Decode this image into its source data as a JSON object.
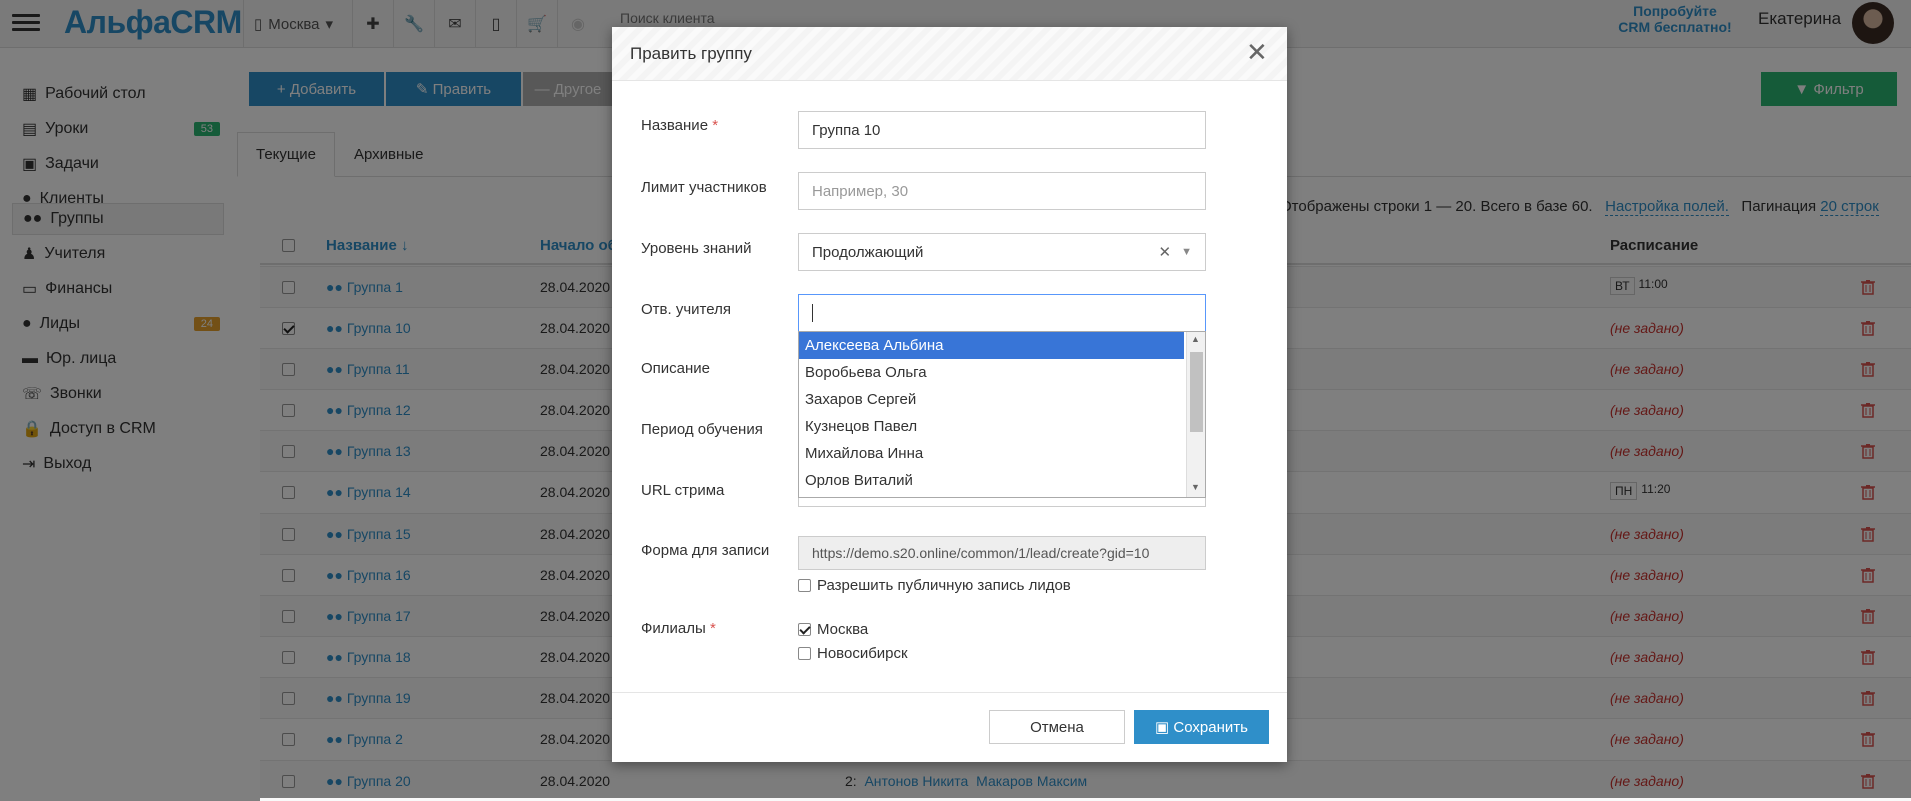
{
  "colors": {
    "primary": "#2f8fc9",
    "teal": "#2bb673",
    "orange": "#e6a12c",
    "danger": "#c9302c",
    "highlight": "#3875d7"
  },
  "topbar": {
    "logo": "АльфаCRM",
    "branch": "Москва",
    "search_placeholder": "Поиск клиента",
    "promo": [
      "Попробуйте",
      "CRM бесплатно!"
    ],
    "user": "Екатерина",
    "icons": [
      "plus-icon",
      "wrench-icon",
      "envelope-icon",
      "mobile-icon",
      "cart-icon"
    ]
  },
  "sidebar": {
    "items": [
      {
        "label": "Рабочий стол",
        "icon": "map-icon"
      },
      {
        "label": "Уроки",
        "icon": "book-icon",
        "badge": "53",
        "badge_color": "#2bb673"
      },
      {
        "label": "Задачи",
        "icon": "clipboard-icon"
      },
      {
        "label": "Клиенты",
        "icon": "user-icon"
      },
      {
        "label": "Группы",
        "icon": "users-icon",
        "active": true
      },
      {
        "label": "Учителя",
        "icon": "teacher-icon"
      },
      {
        "label": "Финансы",
        "icon": "money-icon"
      },
      {
        "label": "Лиды",
        "icon": "lead-icon",
        "badge": "24",
        "badge_color": "#e6a12c"
      },
      {
        "label": "Юр. лица",
        "icon": "briefcase-icon"
      },
      {
        "label": "Звонки",
        "icon": "phone-icon"
      },
      {
        "label": "Доступ в CRM",
        "icon": "lock-icon"
      },
      {
        "label": "Выход",
        "icon": "signout-icon"
      }
    ]
  },
  "toolbar": {
    "add": "+ Добавить",
    "edit": "Править",
    "other": "— Другое",
    "filter": "Фильтр"
  },
  "tabs": {
    "current": "Текущие",
    "archive": "Архивные"
  },
  "table_info": {
    "text": "Отображены строки 1 — 20. Всего в базе 60.",
    "fields": "Настройка полей.",
    "pagination_label": "Пагинация",
    "pagination_value": "20 строк"
  },
  "table": {
    "headers": {
      "name": "Название ↓",
      "start": "Начало об",
      "schedule": "Расписание"
    },
    "rows": [
      {
        "name": "Группа 1",
        "date": "28.04.2020",
        "sched_day": "ВТ",
        "sched_time": "11:00",
        "checked": false
      },
      {
        "name": "Группа 10",
        "date": "28.04.2020",
        "sched": "(не задано)",
        "checked": true
      },
      {
        "name": "Группа 11",
        "date": "28.04.2020",
        "sched": "(не задано)",
        "checked": false
      },
      {
        "name": "Группа 12",
        "date": "28.04.2020",
        "sched": "(не задано)",
        "checked": false
      },
      {
        "name": "Группа 13",
        "date": "28.04.2020",
        "sched": "(не задано)",
        "checked": false
      },
      {
        "name": "Группа 14",
        "date": "28.04.2020",
        "sched_day": "ПН",
        "sched_time": "11:20",
        "checked": false
      },
      {
        "name": "Группа 15",
        "date": "28.04.2020",
        "sched": "(не задано)",
        "checked": false
      },
      {
        "name": "Группа 16",
        "date": "28.04.2020",
        "sched": "(не задано)",
        "checked": false
      },
      {
        "name": "Группа 17",
        "date": "28.04.2020",
        "sched": "(не задано)",
        "checked": false
      },
      {
        "name": "Группа 18",
        "date": "28.04.2020",
        "sched": "(не задано)",
        "checked": false
      },
      {
        "name": "Группа 19",
        "date": "28.04.2020",
        "sched": "(не задано)",
        "checked": false
      },
      {
        "name": "Группа 2",
        "date": "28.04.2020",
        "sched": "(не задано)",
        "checked": false
      },
      {
        "name": "Группа 20",
        "date": "28.04.2020",
        "sched": "(не задано)",
        "checked": false,
        "members": [
          "2:",
          "Антонов Никита",
          "Макаров Максим"
        ]
      }
    ]
  },
  "modal": {
    "title": "Править группу",
    "name_label": "Название",
    "name_value": "Группа 10",
    "limit_label": "Лимит участников",
    "limit_placeholder": "Например, 30",
    "level_label": "Уровень знаний",
    "level_value": "Продолжающий",
    "teacher_label": "Отв. учителя",
    "teacher_options": [
      "Алексеева Альбина",
      "Воробьева Ольга",
      "Захаров Сергей",
      "Кузнецов Павел",
      "Михайлова Инна",
      "Орлов Виталий"
    ],
    "desc_label": "Описание",
    "period_label": "Период обучения",
    "url_label": "URL стрима",
    "form_label": "Форма для записи",
    "form_value": "https://demo.s20.online/common/1/lead/create?gid=10",
    "public_label": "Разрешить публичную запись лидов",
    "branches_label": "Филиалы",
    "branches": [
      {
        "label": "Москва",
        "checked": true
      },
      {
        "label": "Новосибирск",
        "checked": false
      }
    ],
    "cancel": "Отмена",
    "save": "Сохранить"
  }
}
